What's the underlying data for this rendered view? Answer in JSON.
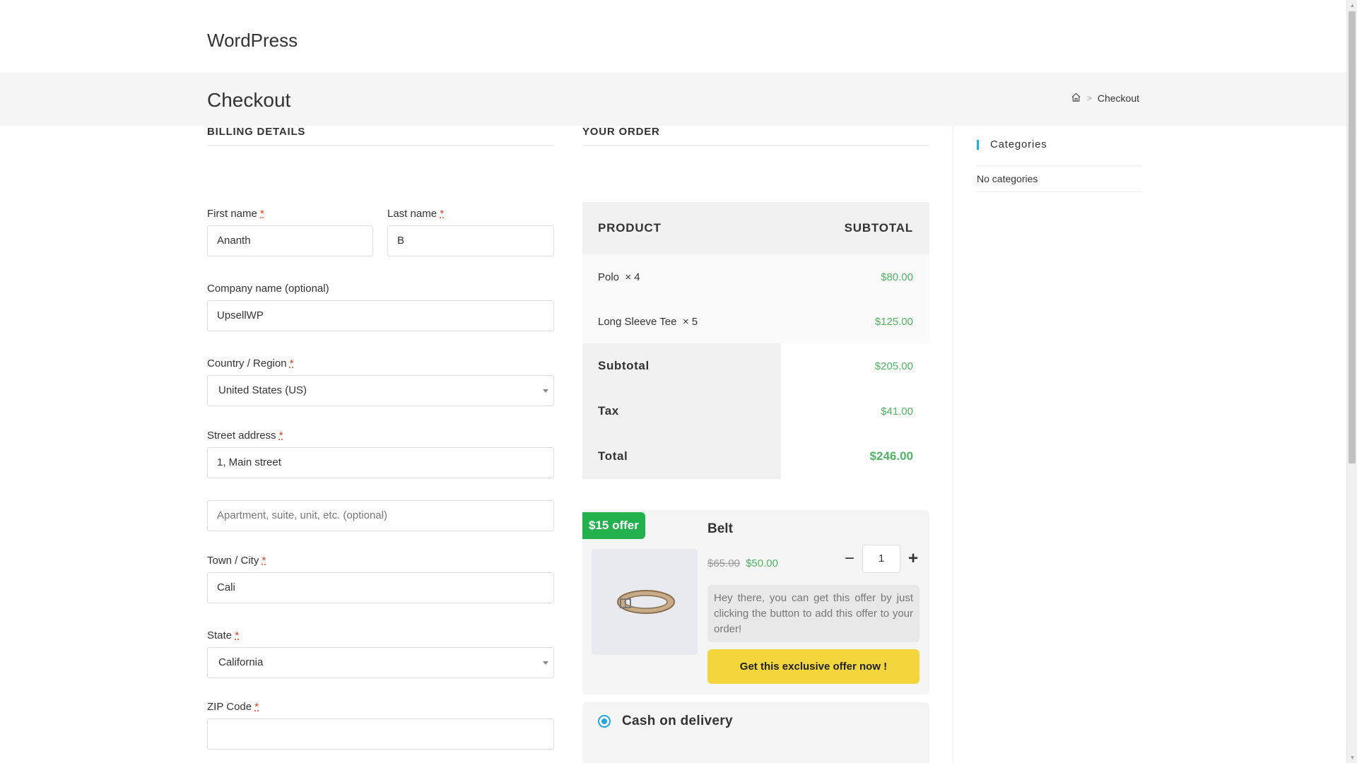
{
  "site": {
    "title": "WordPress"
  },
  "page_header": {
    "title": "Checkout",
    "breadcrumb": {
      "home_icon": "home-icon",
      "separator": ">",
      "current": "Checkout"
    }
  },
  "billing": {
    "heading": "BILLING DETAILS",
    "required_mark": "*",
    "first_name": {
      "label": "First name",
      "value": "Ananth"
    },
    "last_name": {
      "label": "Last name",
      "value": "B"
    },
    "company": {
      "label": "Company name (optional)",
      "value": "UpsellWP"
    },
    "country": {
      "label": "Country / Region",
      "value": "United States (US)"
    },
    "street": {
      "label": "Street address",
      "value": "1, Main street",
      "placeholder2": "Apartment, suite, unit, etc. (optional)"
    },
    "city": {
      "label": "Town / City",
      "value": "Cali"
    },
    "state": {
      "label": "State",
      "value": "California"
    },
    "zip": {
      "label": "ZIP Code",
      "value": ""
    }
  },
  "order": {
    "heading": "YOUR ORDER",
    "col_product": "PRODUCT",
    "col_subtotal": "SUBTOTAL",
    "items": [
      {
        "name": "Polo",
        "qty": "× 4",
        "price": "$80.00"
      },
      {
        "name": "Long Sleeve Tee",
        "qty": "× 5",
        "price": "$125.00"
      }
    ],
    "subtotal": {
      "label": "Subtotal",
      "value": "$205.00"
    },
    "tax": {
      "label": "Tax",
      "value": "$41.00"
    },
    "total": {
      "label": "Total",
      "value": "$246.00"
    }
  },
  "offer": {
    "badge": "$15 offer",
    "title": "Belt",
    "old_price": "$65.00",
    "new_price": "$50.00",
    "quantity": "1",
    "minus": "−",
    "plus": "+",
    "message": "Hey there, you can get this offer by just clicking the button to add this offer to your order!",
    "cta": "Get this exclusive offer now !"
  },
  "payment": {
    "method": "Cash on delivery"
  },
  "sidebar": {
    "widget_title": "Categories",
    "empty_text": "No categories"
  },
  "colors": {
    "accent": "#13aff0",
    "price_green": "#52b365",
    "badge_green": "#22b14c",
    "cta_yellow": "#f2d63b",
    "radio_blue": "#22a7e3"
  }
}
